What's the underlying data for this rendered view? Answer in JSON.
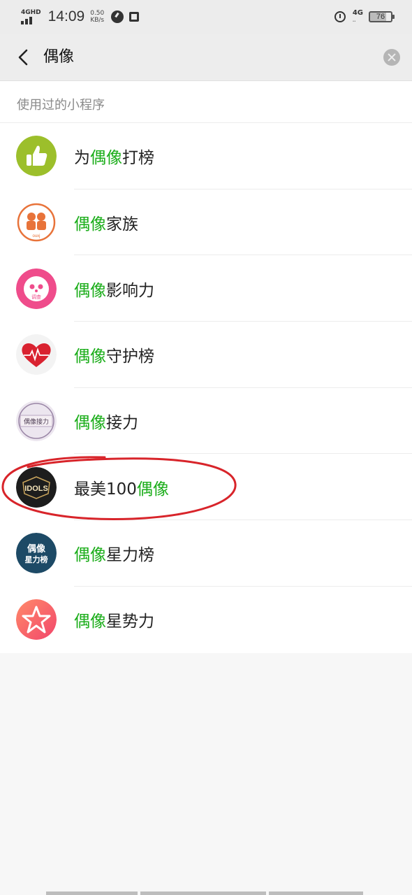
{
  "status_bar": {
    "network_label": "4GHD",
    "time": "14:09",
    "speed_value": "0.50",
    "speed_unit": "KB/s",
    "right_network": "4G",
    "battery": "76"
  },
  "search": {
    "back_icon": "chevron-left-icon",
    "value": "偶像",
    "clear_icon": "clear-circle-icon"
  },
  "results": {
    "section_title": "使用过的小程序",
    "highlight_color": "#1aad19",
    "items": [
      {
        "pre": "为",
        "hl": "偶像",
        "post": "打榜",
        "icon": "thumbs-up-icon"
      },
      {
        "pre": "",
        "hl": "偶像",
        "post": "家族",
        "icon": "family-logo-icon"
      },
      {
        "pre": "",
        "hl": "偶像",
        "post": "影响力",
        "icon": "pink-face-icon"
      },
      {
        "pre": "",
        "hl": "偶像",
        "post": "守护榜",
        "icon": "heart-icon"
      },
      {
        "pre": "",
        "hl": "偶像",
        "post": "接力",
        "icon": "relay-badge-icon"
      },
      {
        "pre": "最美100",
        "hl": "偶像",
        "post": "",
        "icon": "idols-logo-icon"
      },
      {
        "pre": "",
        "hl": "偶像",
        "post": "星力榜",
        "icon": "star-power-logo-icon"
      },
      {
        "pre": "",
        "hl": "偶像",
        "post": "星势力",
        "icon": "star-icon"
      }
    ],
    "icon_texts": {
      "family": "ouxj",
      "face": "调查",
      "relay": "偶像接力",
      "idols": "IDOLS",
      "star_power_top": "偶像",
      "star_power_bottom": "星力榜"
    }
  },
  "annotation": {
    "color": "#d8242a"
  }
}
